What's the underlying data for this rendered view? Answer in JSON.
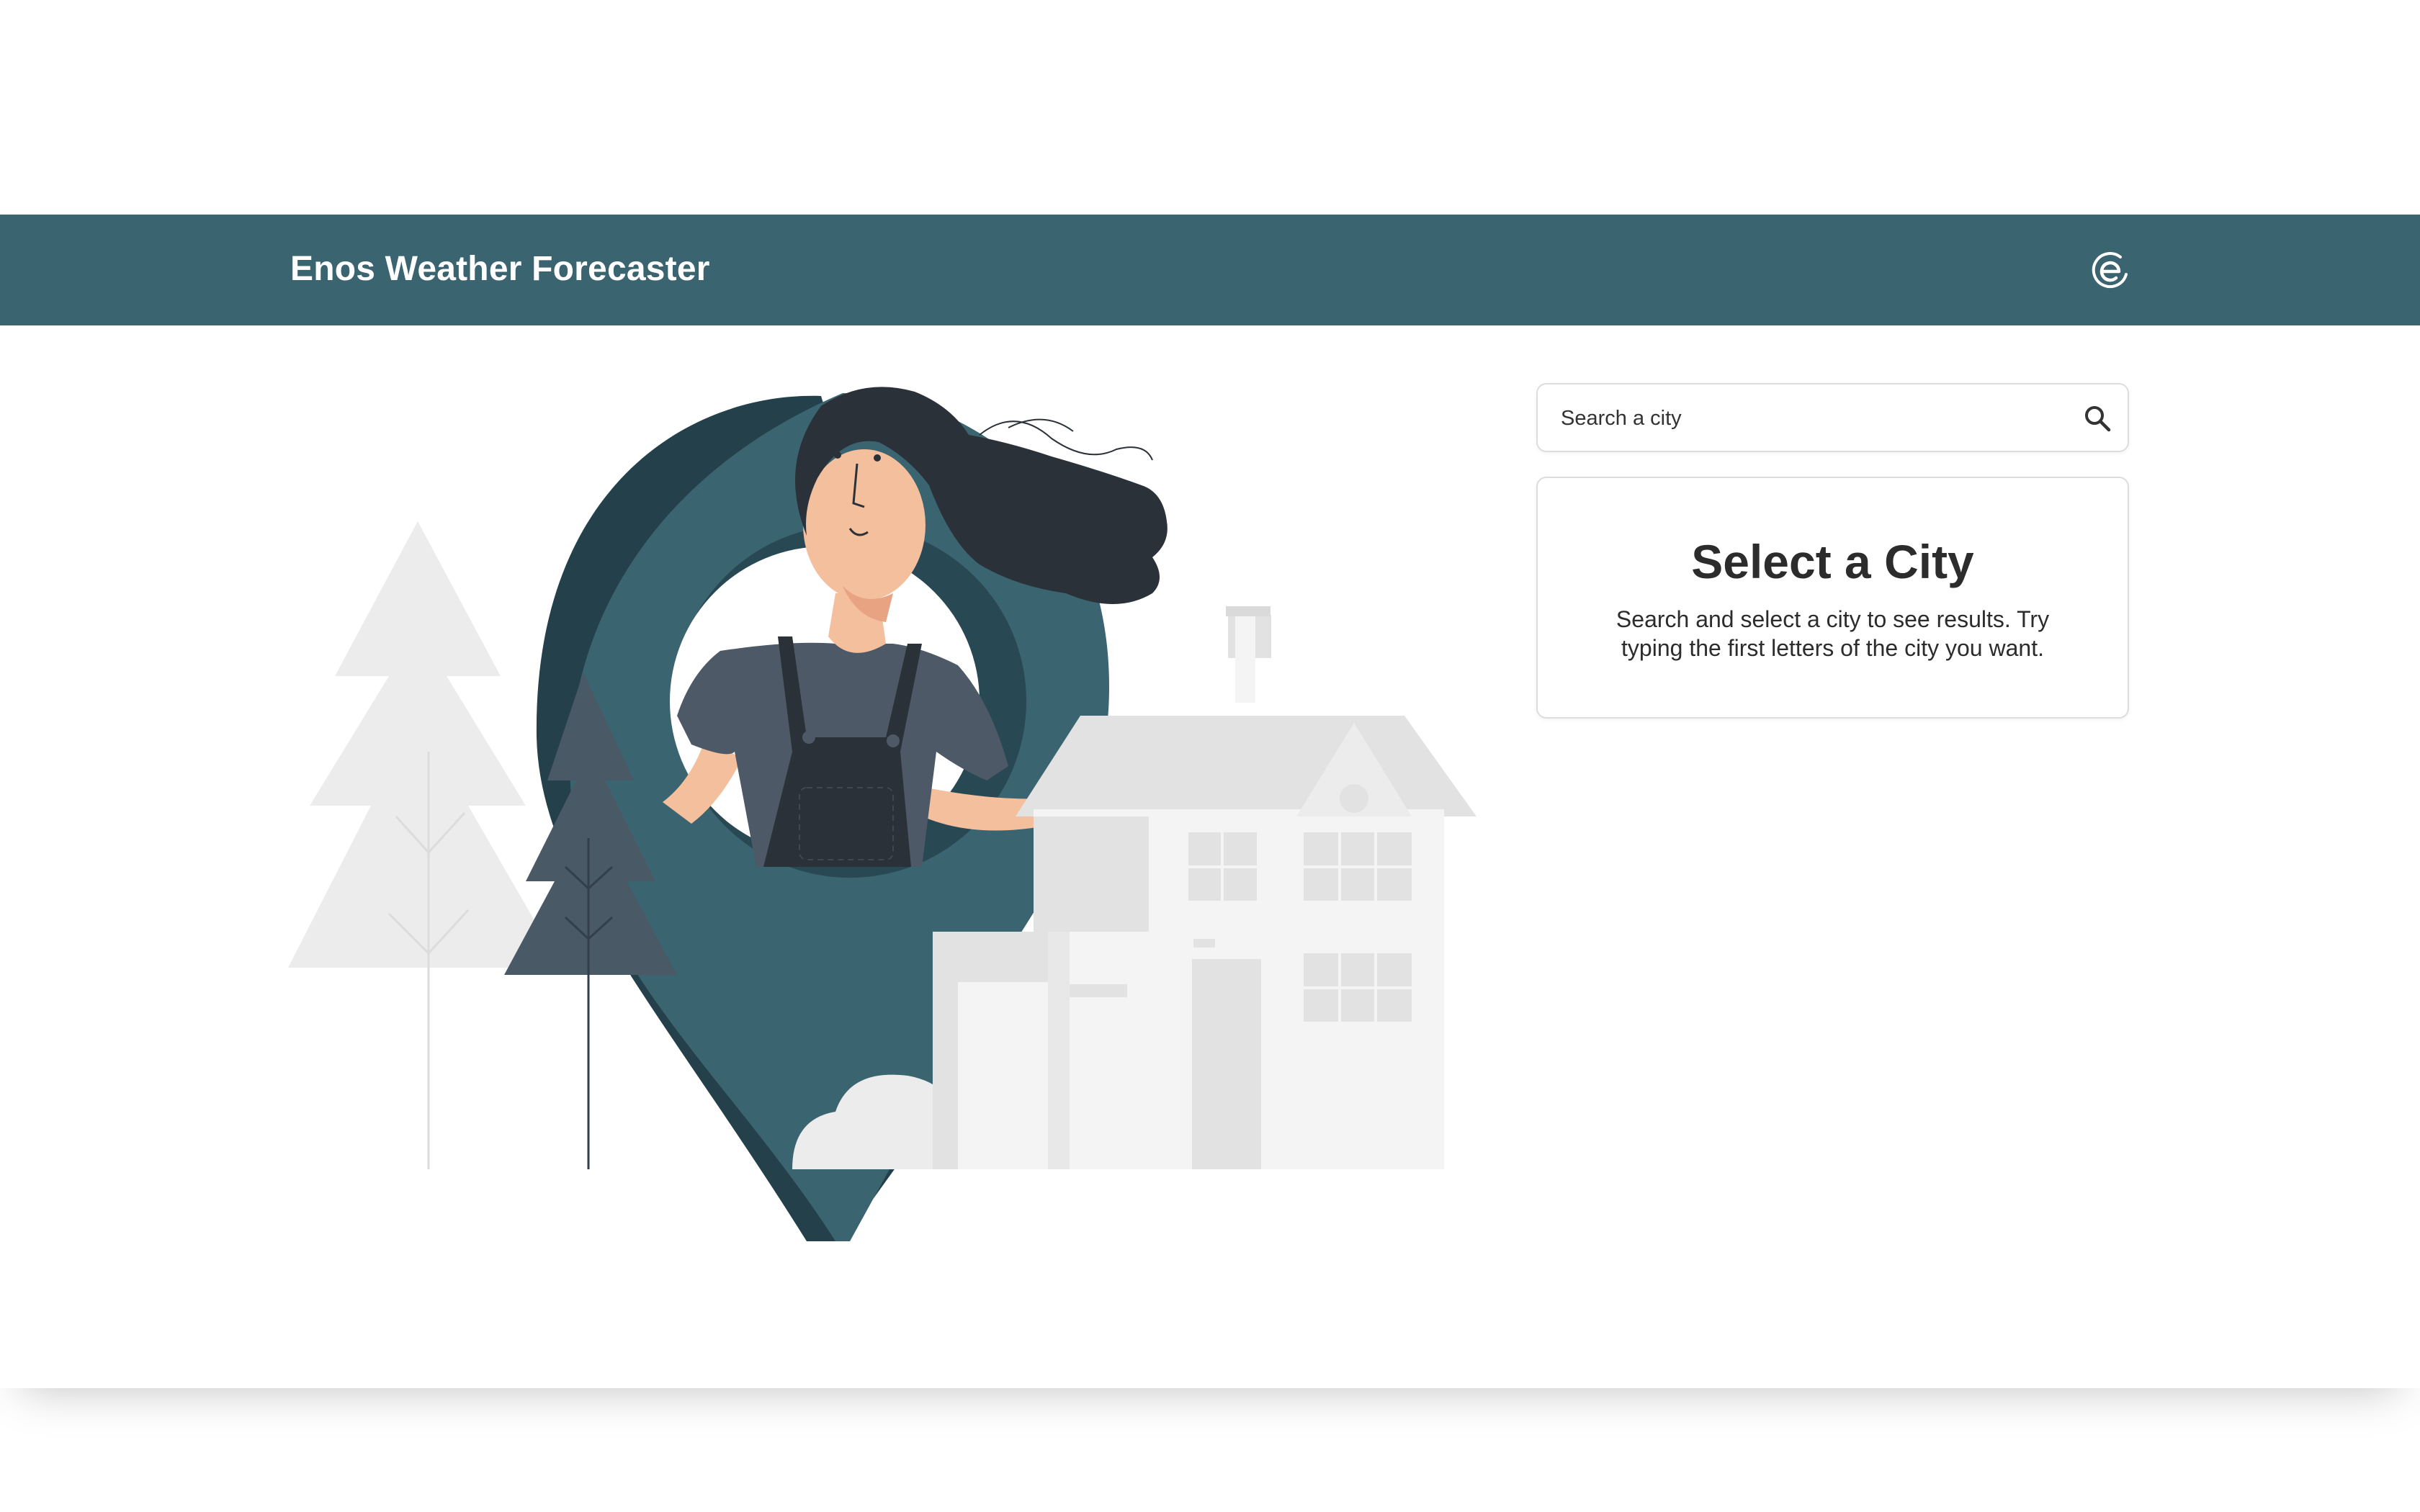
{
  "header": {
    "title": "Enos Weather Forecaster",
    "logo_icon": "enos-logo-icon"
  },
  "search": {
    "placeholder": "Search a city",
    "value": "",
    "icon": "search-icon"
  },
  "empty_state": {
    "title": "Select a City",
    "message": "Search and select a city to see results. Try typing the first letters of the city you want."
  },
  "colors": {
    "header_bg": "#3b6471",
    "pin": "#3b6471",
    "pin_shadow": "#24404a",
    "hair": "#2a3138",
    "skin": "#f4bf9d"
  }
}
